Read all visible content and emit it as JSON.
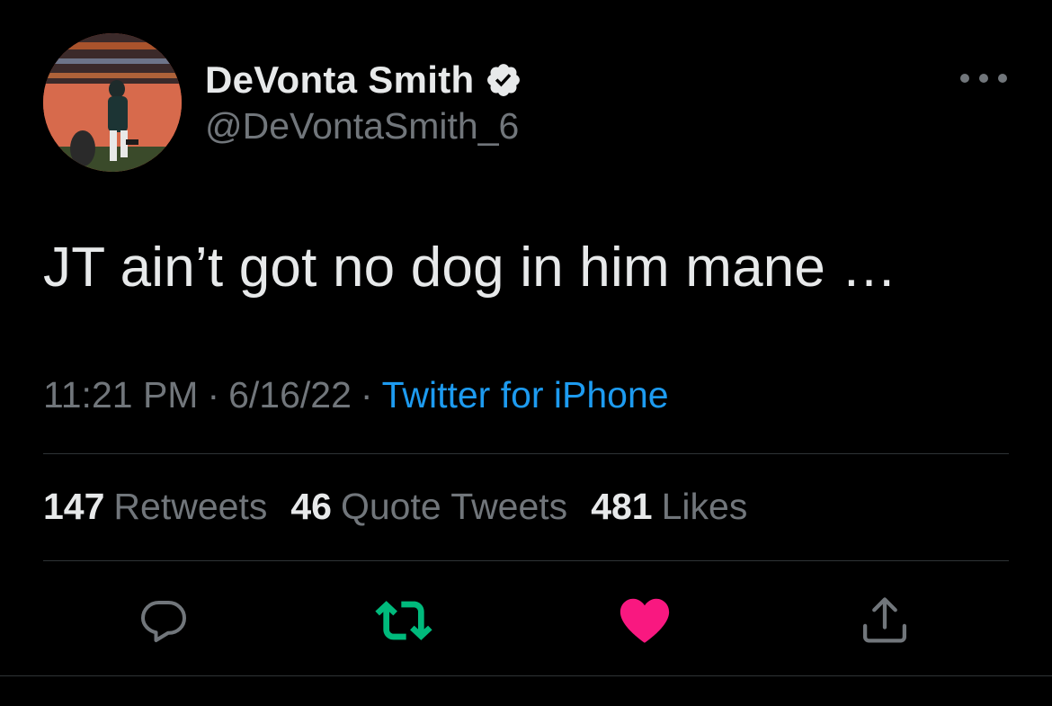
{
  "author": {
    "display_name": "DeVonta Smith",
    "handle": "@DeVontaSmith_6",
    "verified": true
  },
  "icons": {
    "verified": "verified-badge-icon",
    "more": "more-horizontal-icon",
    "reply": "reply-icon",
    "retweet": "retweet-icon",
    "like": "like-heart-icon",
    "share": "share-icon"
  },
  "tweet": {
    "text": "JT ain’t got no dog in him mane …",
    "time": "11:21 PM",
    "date": "6/16/22",
    "separator": "·",
    "source": "Twitter for iPhone"
  },
  "stats": {
    "retweets": {
      "count": "147",
      "label": "Retweets"
    },
    "quote_tweets": {
      "count": "46",
      "label": "Quote Tweets"
    },
    "likes": {
      "count": "481",
      "label": "Likes"
    }
  },
  "colors": {
    "background": "#000000",
    "text_primary": "#e7e9ea",
    "text_secondary": "#71767b",
    "link": "#1d9bf0",
    "retweet_active": "#00ba7c",
    "like_active": "#f91880",
    "divider": "#2f3336"
  },
  "state": {
    "retweeted": true,
    "liked": true
  }
}
